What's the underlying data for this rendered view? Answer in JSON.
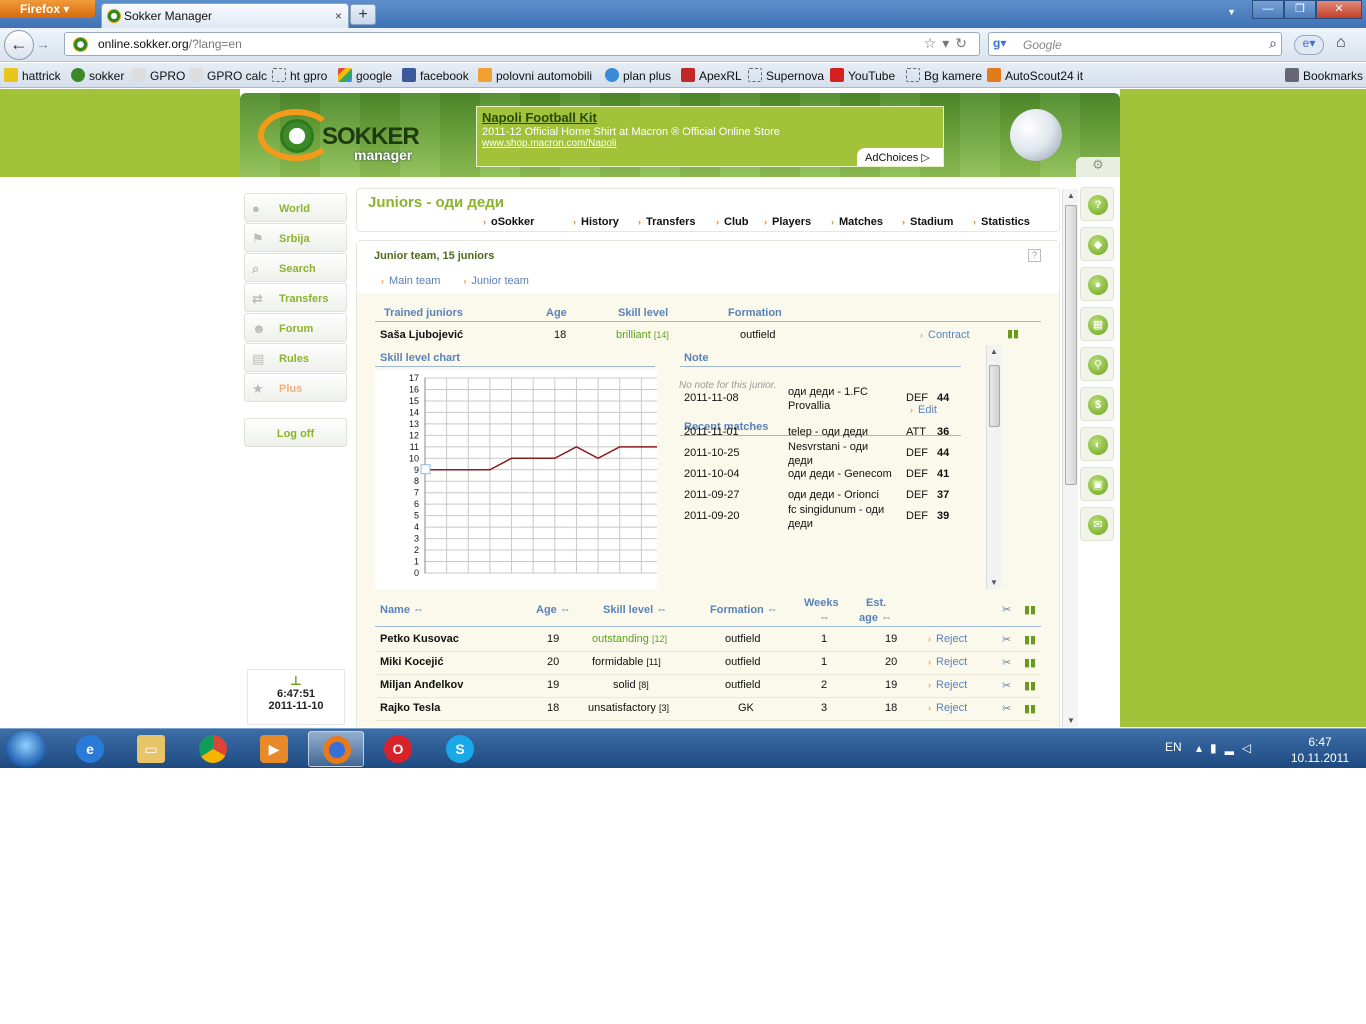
{
  "browser": {
    "app_button": "Firefox",
    "tab_title": "Sokker Manager",
    "url_domain": "online.sokker.org",
    "url_path": "/?lang=en",
    "search_placeholder": "Google",
    "bookmarks": [
      "hattrick",
      "sokker",
      "GPRO",
      "GPRO calc",
      "ht gpro",
      "google",
      "facebook",
      "polovni automobili",
      "plan plus",
      "ApexRL",
      "Supernova",
      "YouTube",
      "Bg kamere",
      "AutoScout24 it"
    ],
    "bookmarks_menu": "Bookmarks"
  },
  "header": {
    "logo_line1": "SOKKER",
    "logo_line2": "manager",
    "ad": {
      "title": "Napoli Football Kit",
      "desc": "2011-12 Official Home Shirt at Macron ® Official Online Store",
      "url": "www.shop.macron.com/Napoli",
      "choices": "AdChoices"
    }
  },
  "leftnav": [
    "World",
    "Srbija",
    "Search",
    "Transfers",
    "Forum",
    "Rules",
    "Plus"
  ],
  "logoff": "Log off",
  "clock": {
    "time": "6:47:51",
    "date": "2011-11-10"
  },
  "page": {
    "title": "Juniors - оди деди",
    "tabs": [
      "oSokker",
      "History",
      "Transfers",
      "Club",
      "Players",
      "Matches",
      "Stadium",
      "Statistics"
    ]
  },
  "panel": {
    "heading": "Junior team, 15 juniors",
    "help": "?",
    "subtabs": [
      "Main team",
      "Junior team"
    ],
    "trained": {
      "headers": [
        "Trained juniors",
        "Age",
        "Skill level",
        "Formation"
      ],
      "name": "Saša Ljubojević",
      "age": "18",
      "skill": "brilliant",
      "skill_num": "[14]",
      "formation": "outfield",
      "action": "Contract"
    },
    "chart_title": "Skill level chart",
    "note_title": "Note",
    "note_text": "No note for this junior.",
    "note_edit": "Edit",
    "recent_title": "Recent matches",
    "recent": [
      {
        "date": "2011-11-08",
        "match": "оди деди - 1.FC Provallia",
        "pos": "DEF",
        "rating": "44"
      },
      {
        "date": "2011-11-01",
        "match": "telep - оди деди",
        "pos": "ATT",
        "rating": "36"
      },
      {
        "date": "2011-10-25",
        "match": "Nesvrstani - оди деди",
        "pos": "DEF",
        "rating": "44"
      },
      {
        "date": "2011-10-04",
        "match": "оди деди - Genecom",
        "pos": "DEF",
        "rating": "41"
      },
      {
        "date": "2011-09-27",
        "match": "оди деди - Orionci",
        "pos": "DEF",
        "rating": "37"
      },
      {
        "date": "2011-09-20",
        "match": "fc singidunum - оди деди",
        "pos": "DEF",
        "rating": "39"
      }
    ],
    "list_headers": {
      "name": "Name ⇔",
      "age": "Age ⇔",
      "skill": "Skill level ⇔",
      "formation": "Formation ⇔",
      "weeks": "Weeks",
      "weeks2": "⇔",
      "est": "Est.",
      "est2": "age ⇔"
    },
    "juniors": [
      {
        "name": "Petko Kusovac",
        "age": "19",
        "skill": "outstanding",
        "num": "[12]",
        "formation": "outfield",
        "weeks": "1",
        "est": "19",
        "action": "Reject"
      },
      {
        "name": "Miki Kocejić",
        "age": "20",
        "skill": "formidable",
        "num": "[11]",
        "formation": "outfield",
        "weeks": "1",
        "est": "20",
        "action": "Reject"
      },
      {
        "name": "Miljan Anđelkov",
        "age": "19",
        "skill": "solid",
        "num": "[8]",
        "formation": "outfield",
        "weeks": "2",
        "est": "19",
        "action": "Reject"
      },
      {
        "name": "Rajko Tesla",
        "age": "18",
        "skill": "unsatisfactory",
        "num": "[3]",
        "formation": "GK",
        "weeks": "3",
        "est": "18",
        "action": "Reject"
      }
    ]
  },
  "chart_data": {
    "type": "line",
    "title": "Skill level chart",
    "xlabel": "",
    "ylabel": "",
    "ylim": [
      0,
      17
    ],
    "yticks": [
      0,
      1,
      2,
      3,
      4,
      5,
      6,
      7,
      8,
      9,
      10,
      11,
      12,
      13,
      14,
      15,
      16,
      17
    ],
    "x": [
      0,
      1,
      2,
      3,
      4,
      5,
      6,
      7,
      8,
      9,
      10,
      11
    ],
    "values": [
      9,
      9,
      9,
      9,
      10,
      10,
      10,
      11,
      10,
      11,
      11,
      11
    ],
    "line_color": "#8b1a1a",
    "grid": true
  },
  "taskbar": {
    "lang": "EN",
    "time": "6:47",
    "date": "10.11.2011"
  }
}
